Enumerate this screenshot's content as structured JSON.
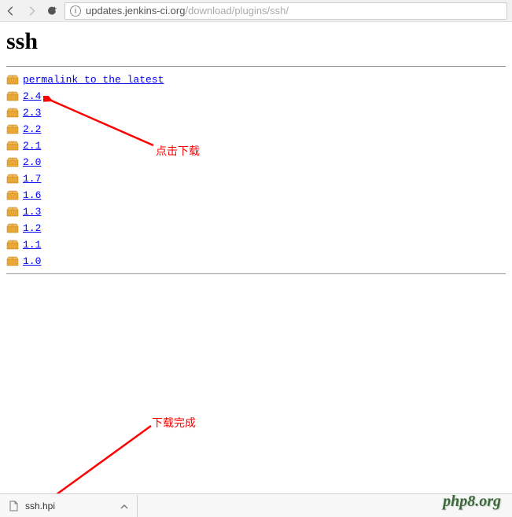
{
  "browser": {
    "url_host": "updates.jenkins-ci.org",
    "url_path": "/download/plugins/ssh/"
  },
  "page": {
    "title": "ssh",
    "permalink_label": "permalink to the latest",
    "versions": [
      "2.4",
      "2.3",
      "2.2",
      "2.1",
      "2.0",
      "1.7",
      "1.6",
      "1.3",
      "1.2",
      "1.1",
      "1.0"
    ]
  },
  "annotations": {
    "click_download": "点击下载",
    "download_complete": "下载完成"
  },
  "download": {
    "file_name": "ssh.hpi"
  },
  "watermark": "php8.org"
}
